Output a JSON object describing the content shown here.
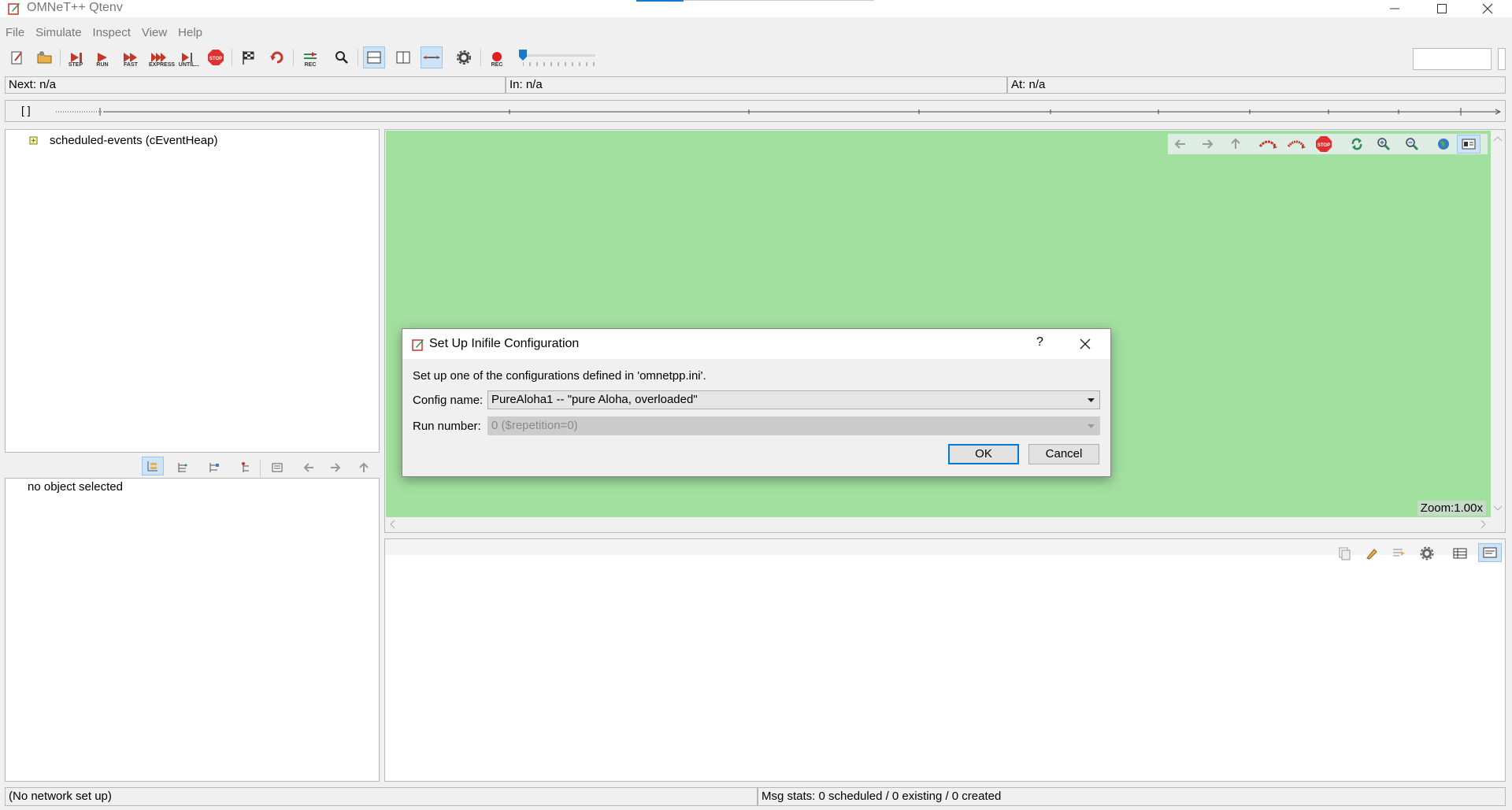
{
  "window": {
    "title": "OMNeT++ Qtenv"
  },
  "menu": [
    "File",
    "Simulate",
    "Inspect",
    "View",
    "Help"
  ],
  "toolbar": {
    "step_label": "STEP",
    "run_label": "RUN",
    "fast_label": "FAST",
    "express_label": "EXPRESS",
    "until_label": "UNTIL...",
    "stop_label": "STOP",
    "rec_label": "REC"
  },
  "status": {
    "next": "Next: n/a",
    "in": "In: n/a",
    "at": "At: n/a"
  },
  "timeline": {
    "brackets": "[  ]"
  },
  "object_tree": {
    "items": [
      {
        "label": "scheduled-events (cEventHeap)"
      }
    ]
  },
  "object_inspector": {
    "empty_text": "no object selected"
  },
  "canvas": {
    "zoom": "Zoom:1.00x",
    "background": "#a2e0a0"
  },
  "dialog": {
    "title": "Set Up Inifile Configuration",
    "help": "?",
    "intro": "Set up one of the configurations defined in 'omnetpp.ini'.",
    "config_label": "Config name:",
    "config_value": "PureAloha1 -- \"pure Aloha, overloaded\"",
    "run_label": "Run number:",
    "run_value": "0 ($repetition=0)",
    "ok": "OK",
    "cancel": "Cancel"
  },
  "statusbar": {
    "network": "(No network set up)",
    "msg_stats": "Msg stats: 0 scheduled / 0 existing / 0 created"
  }
}
